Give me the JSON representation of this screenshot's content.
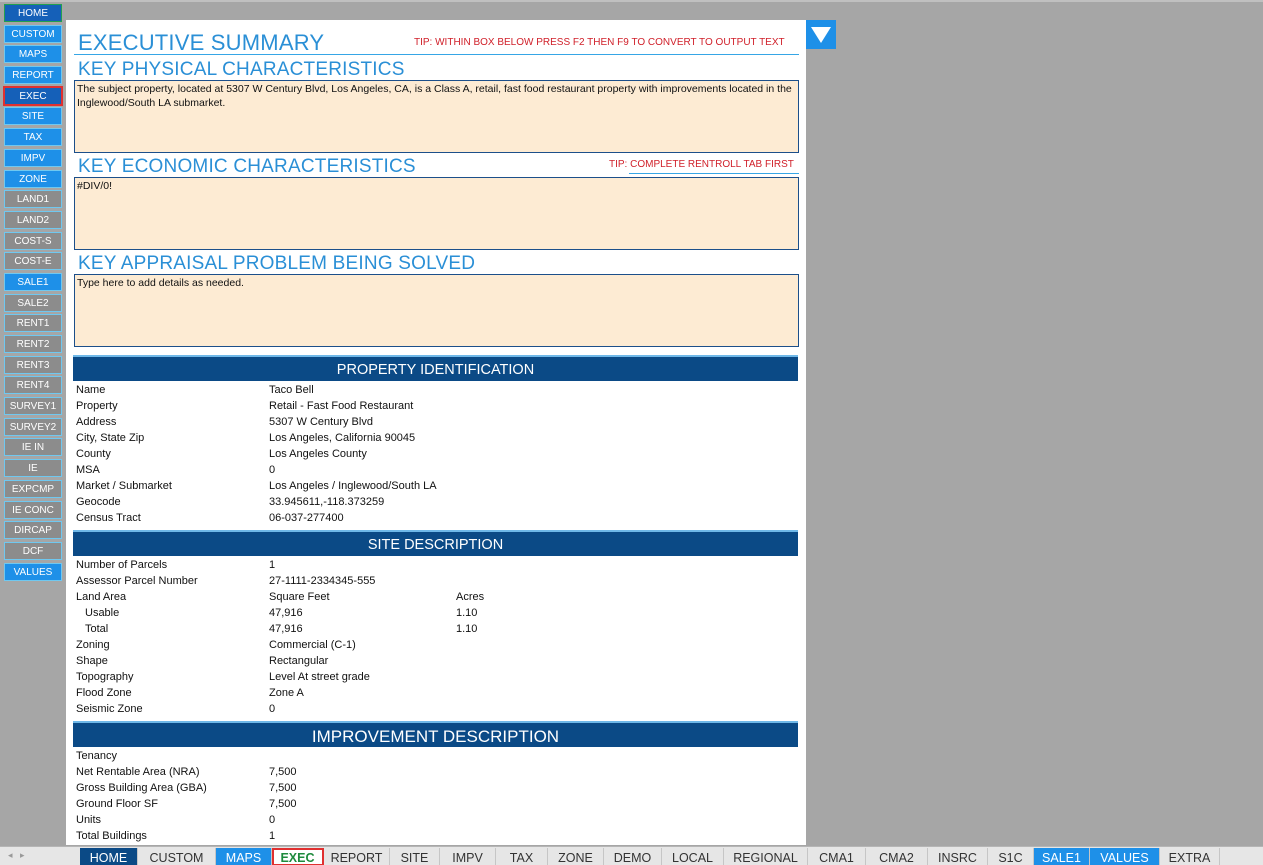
{
  "left_nav": [
    {
      "label": "HOME",
      "style": "darkblue"
    },
    {
      "label": "CUSTOM",
      "style": "blue"
    },
    {
      "label": "MAPS",
      "style": "blue"
    },
    {
      "label": "REPORT",
      "style": "blue"
    },
    {
      "label": "EXEC",
      "style": "active"
    },
    {
      "label": "SITE",
      "style": "blue"
    },
    {
      "label": "TAX",
      "style": "blue"
    },
    {
      "label": "IMPV",
      "style": "blue"
    },
    {
      "label": "ZONE",
      "style": "blue"
    },
    {
      "label": "LAND1",
      "style": "gray"
    },
    {
      "label": "LAND2",
      "style": "gray"
    },
    {
      "label": "COST-S",
      "style": "gray"
    },
    {
      "label": "COST-E",
      "style": "gray"
    },
    {
      "label": "SALE1",
      "style": "blue"
    },
    {
      "label": "SALE2",
      "style": "gray"
    },
    {
      "label": "RENT1",
      "style": "gray"
    },
    {
      "label": "RENT2",
      "style": "gray"
    },
    {
      "label": "RENT3",
      "style": "gray"
    },
    {
      "label": "RENT4",
      "style": "gray"
    },
    {
      "label": "SURVEY1",
      "style": "gray"
    },
    {
      "label": "SURVEY2",
      "style": "gray"
    },
    {
      "label": "IE IN",
      "style": "gray"
    },
    {
      "label": "IE",
      "style": "gray"
    },
    {
      "label": "EXPCMP",
      "style": "gray"
    },
    {
      "label": "IE CONC",
      "style": "gray"
    },
    {
      "label": "DIRCAP",
      "style": "gray"
    },
    {
      "label": "DCF",
      "style": "gray"
    },
    {
      "label": "VALUES",
      "style": "blue"
    }
  ],
  "exec": {
    "title": "EXECUTIVE SUMMARY",
    "tip_top": "TIP: WITHIN BOX BELOW PRESS F2 THEN F9 TO CONVERT TO OUTPUT TEXT",
    "physical_heading": "KEY PHYSICAL CHARACTERISTICS",
    "physical_text": "The subject property, located at 5307 W Century Blvd, Los Angeles, CA, is a Class A, retail, fast food restaurant property with improvements located in the Inglewood/South LA submarket.",
    "economic_heading": "KEY ECONOMIC CHARACTERISTICS",
    "tip_economic": "TIP: COMPLETE RENTROLL TAB FIRST",
    "economic_text": "#DIV/0!",
    "problem_heading": "KEY APPRAISAL PROBLEM BEING SOLVED",
    "problem_text": "Type here to add details as needed."
  },
  "property_identification": {
    "title": "PROPERTY IDENTIFICATION",
    "rows": [
      [
        "Name",
        "Taco Bell"
      ],
      [
        "Property",
        "Retail - Fast Food Restaurant"
      ],
      [
        "Address",
        "5307 W Century Blvd"
      ],
      [
        "City, State Zip",
        "Los Angeles, California 90045"
      ],
      [
        "County",
        "Los Angeles County"
      ],
      [
        "MSA",
        "0"
      ],
      [
        "Market / Submarket",
        "Los Angeles / Inglewood/South LA"
      ],
      [
        "Geocode",
        "33.945611,-118.373259"
      ],
      [
        "Census Tract",
        "06-037-277400"
      ]
    ]
  },
  "site_description": {
    "title": "SITE DESCRIPTION",
    "rows": [
      [
        "Number of Parcels",
        "1",
        ""
      ],
      [
        "Assessor Parcel Number",
        "27-1111-2334345-555",
        ""
      ],
      [
        "Land Area",
        "Square Feet",
        "Acres"
      ],
      [
        "Usable",
        "47,916",
        "1.10"
      ],
      [
        "Total",
        "47,916",
        "1.10"
      ],
      [
        "Zoning",
        "Commercial (C-1)",
        ""
      ],
      [
        "Shape",
        "Rectangular",
        ""
      ],
      [
        "Topography",
        "Level At street grade",
        ""
      ],
      [
        "Flood Zone",
        "Zone A",
        ""
      ],
      [
        "Seismic Zone",
        "0",
        ""
      ]
    ]
  },
  "improvement_description": {
    "title": "IMPROVEMENT DESCRIPTION",
    "rows": [
      [
        "Tenancy",
        ""
      ],
      [
        "Net Rentable Area (NRA)",
        "7,500"
      ],
      [
        "Gross Building Area (GBA)",
        "7,500"
      ],
      [
        "Ground Floor SF",
        "7,500"
      ],
      [
        "Units",
        "0"
      ],
      [
        "Total Buildings",
        "1"
      ]
    ]
  },
  "sheet_tabs": [
    {
      "label": "HOME",
      "style": "home"
    },
    {
      "label": "CUSTOM",
      "style": ""
    },
    {
      "label": "MAPS",
      "style": "blue"
    },
    {
      "label": "EXEC",
      "style": "active"
    },
    {
      "label": "REPORT",
      "style": ""
    },
    {
      "label": "SITE",
      "style": ""
    },
    {
      "label": "IMPV",
      "style": ""
    },
    {
      "label": "TAX",
      "style": ""
    },
    {
      "label": "ZONE",
      "style": ""
    },
    {
      "label": "DEMO",
      "style": ""
    },
    {
      "label": "LOCAL",
      "style": ""
    },
    {
      "label": "REGIONAL",
      "style": ""
    },
    {
      "label": "CMA1",
      "style": ""
    },
    {
      "label": "CMA2",
      "style": ""
    },
    {
      "label": "INSRC",
      "style": ""
    },
    {
      "label": "S1C",
      "style": ""
    },
    {
      "label": "SALE1",
      "style": "blue"
    },
    {
      "label": "VALUES",
      "style": "blue"
    },
    {
      "label": "EXTRA",
      "style": ""
    }
  ],
  "icons": {
    "dropdown": "chevron-down-icon"
  },
  "colors": {
    "accent": "#1e90e8",
    "band": "#0b4a86",
    "textbox": "#fdebd3",
    "tip": "#d0202a"
  }
}
